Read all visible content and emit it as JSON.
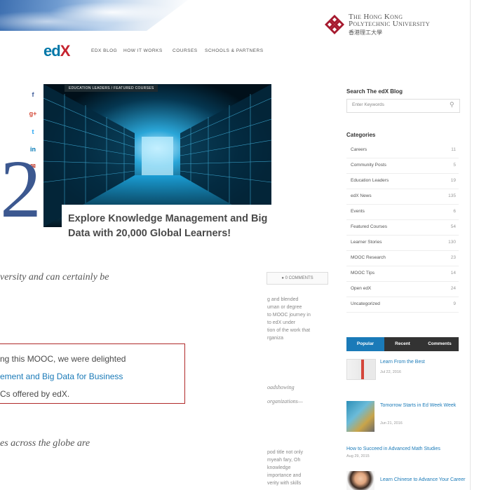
{
  "university": {
    "name_line1": "The Hong Kong",
    "name_line2": "Polytechnic University",
    "name_cn": "香港理工大學"
  },
  "edx": {
    "logo_ed": "ed",
    "logo_x": "X",
    "nav": [
      "EDX BLOG",
      "HOW IT WORKS",
      "COURSES",
      "SCHOOLS & PARTNERS"
    ]
  },
  "share": [
    "f",
    "g+",
    "t",
    "in",
    "✉"
  ],
  "hero": {
    "breadcrumb": "EDUCATION LEADERS  /  FEATURED COURSES",
    "title": "Explore Knowledge Management and Big Data with 20,000 Global Learners!",
    "quote_mark": "2"
  },
  "article": {
    "italic_1": "versity and can certainly be",
    "quote_lines": [
      "ng this MOOC, we were delighted",
      "ement and Big Data for Business",
      "Cs offered by edX."
    ],
    "italic_2": "es across the globe are",
    "comments_button": "0 COMMENTS",
    "mid_block_1": [
      "g and blended",
      "uman or degree",
      "to MOOC journey in",
      "to edX under",
      "tion of the work that",
      "rganiza"
    ],
    "mid_italic": [
      "oadshowing",
      "organizations—"
    ],
    "mid_block_2": [
      "pod title not only",
      "myeah fary, Oh",
      "knowledge",
      "importance and",
      "verity with skills"
    ]
  },
  "sidebar": {
    "search_heading": "Search The edX Blog",
    "search_placeholder": "Enter Keywords",
    "categories_heading": "Categories",
    "categories": [
      {
        "name": "Careers",
        "count": "11"
      },
      {
        "name": "Community Posts",
        "count": "5"
      },
      {
        "name": "Education Leaders",
        "count": "19"
      },
      {
        "name": "edX News",
        "count": "135"
      },
      {
        "name": "Events",
        "count": "6"
      },
      {
        "name": "Featured Courses",
        "count": "54"
      },
      {
        "name": "Learner Stories",
        "count": "130"
      },
      {
        "name": "MOOC Research",
        "count": "23"
      },
      {
        "name": "MOOC Tips",
        "count": "14"
      },
      {
        "name": "Open edX",
        "count": "24"
      },
      {
        "name": "Uncategorized",
        "count": "9"
      }
    ],
    "tabs": [
      "Popular",
      "Recent",
      "Comments"
    ],
    "posts": [
      {
        "title": "Learn From the Best",
        "date": "Jul 22, 2016"
      },
      {
        "title": "Tomorrow Starts in Ed Week Week",
        "date": "Jun 21, 2016"
      },
      {
        "title": "How to Succeed in Advanced Math Studies",
        "date": "Aug 29, 2015"
      },
      {
        "title": "Learn Chinese to Advance Your Career",
        "date": ""
      }
    ]
  },
  "colors": {
    "accent": "#1a7ab8",
    "popular_tab": "#1a7ab8",
    "dark_tab": "#333333",
    "quote_border": "#b02a2a",
    "polyu_red": "#a6192e"
  }
}
